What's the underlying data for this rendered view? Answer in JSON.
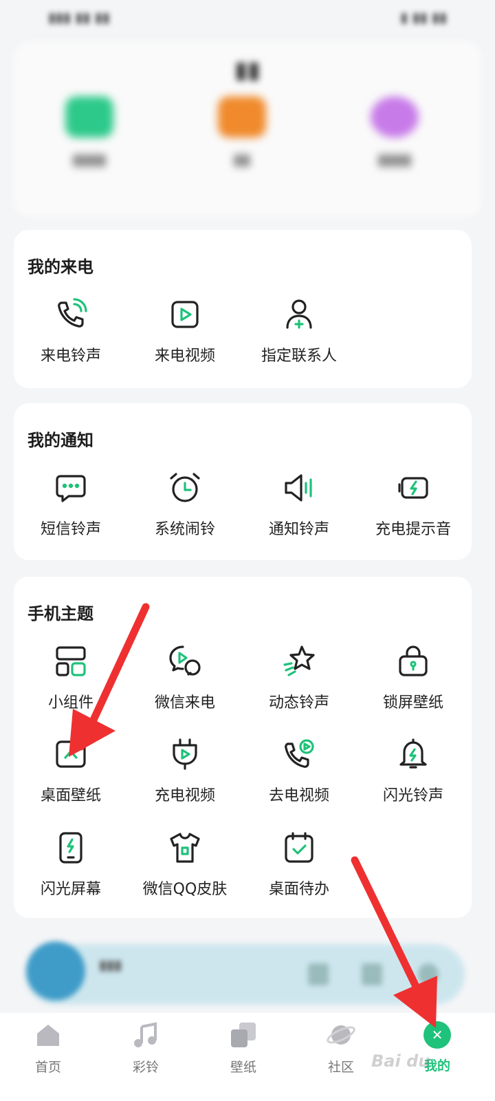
{
  "colors": {
    "accent": "#1ec27a",
    "icon_stroke": "#222222",
    "arrow": "#ef3030",
    "card_bg": "#ffffff",
    "page_bg": "#f4f5f7"
  },
  "sections": [
    {
      "title": "我的来电",
      "items": [
        {
          "label": "来电铃声",
          "icon": "phone-ring-icon"
        },
        {
          "label": "来电视频",
          "icon": "video-play-icon"
        },
        {
          "label": "指定联系人",
          "icon": "contact-add-icon"
        }
      ]
    },
    {
      "title": "我的通知",
      "items": [
        {
          "label": "短信铃声",
          "icon": "message-icon"
        },
        {
          "label": "系统闹铃",
          "icon": "alarm-clock-icon"
        },
        {
          "label": "通知铃声",
          "icon": "speaker-icon"
        },
        {
          "label": "充电提示音",
          "icon": "battery-charge-icon"
        }
      ]
    },
    {
      "title": "手机主题",
      "items": [
        {
          "label": "小组件",
          "icon": "widget-icon"
        },
        {
          "label": "微信来电",
          "icon": "wechat-call-icon"
        },
        {
          "label": "动态铃声",
          "icon": "star-motion-icon"
        },
        {
          "label": "锁屏壁纸",
          "icon": "lock-icon"
        },
        {
          "label": "桌面壁纸",
          "icon": "wallpaper-icon"
        },
        {
          "label": "充电视频",
          "icon": "charger-plug-icon"
        },
        {
          "label": "去电视频",
          "icon": "outgoing-call-video-icon"
        },
        {
          "label": "闪光铃声",
          "icon": "bell-flash-icon"
        },
        {
          "label": "闪光屏幕",
          "icon": "phone-flash-icon"
        },
        {
          "label": "微信QQ皮肤",
          "icon": "tshirt-icon"
        },
        {
          "label": "桌面待办",
          "icon": "calendar-check-icon"
        }
      ]
    }
  ],
  "bottom_nav": [
    {
      "label": "首页",
      "icon": "home-icon",
      "active": false
    },
    {
      "label": "彩铃",
      "icon": "music-note-icon",
      "active": false
    },
    {
      "label": "壁纸",
      "icon": "wallpaper-stack-icon",
      "active": false
    },
    {
      "label": "社区",
      "icon": "planet-icon",
      "active": false
    },
    {
      "label": "我的",
      "icon": "profile-icon",
      "active": true
    }
  ]
}
